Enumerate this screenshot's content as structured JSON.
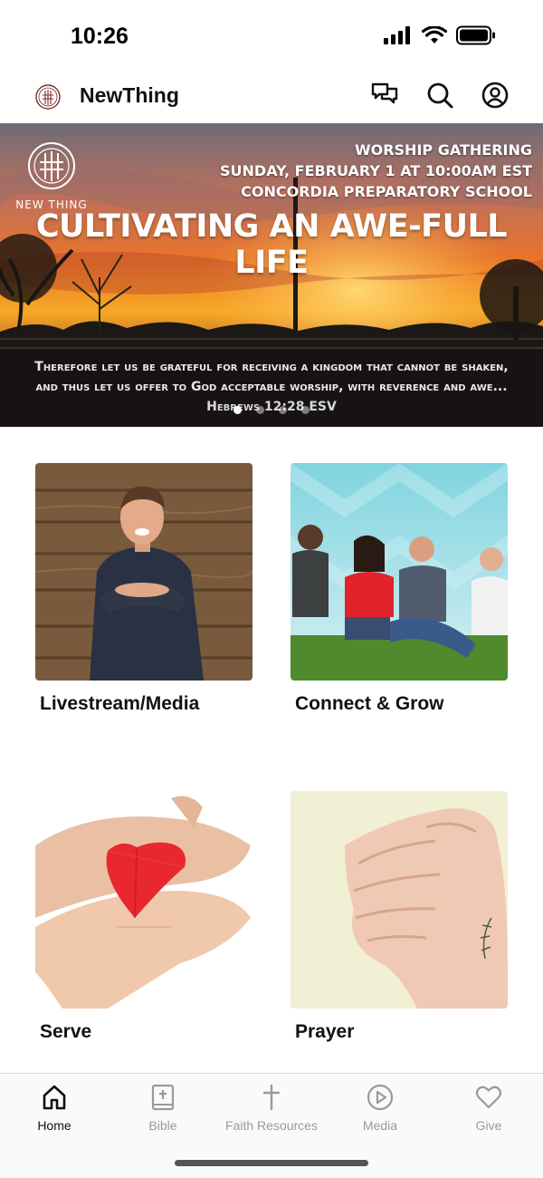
{
  "status_bar": {
    "time": "10:26"
  },
  "app": {
    "title": "NewThing",
    "actions": [
      "chat-icon",
      "search-icon",
      "profile-icon"
    ]
  },
  "hero": {
    "brand": "NEW THING",
    "event_lines": [
      "WORSHIP GATHERING",
      "SUNDAY, FEBRUARY 1 AT 10:00AM EST",
      "CONCORDIA PREPARATORY SCHOOL"
    ],
    "title": "CULTIVATING AN AWE-FULL LIFE",
    "verse_lines": [
      "Therefore let us be grateful for receiving a kingdom that cannot be shaken,",
      "and thus let us offer to God acceptable worship, with reverence and awe..."
    ],
    "verse_ref": "Hebrews 12:28 ESV",
    "carousel": {
      "total": 4,
      "active": 1
    }
  },
  "tiles": [
    {
      "label": "Livestream/Media",
      "image": "man-worship-photo"
    },
    {
      "label": "Connect & Grow",
      "image": "group-photo"
    },
    {
      "label": "Serve",
      "image": "hands-heart-photo"
    },
    {
      "label": "Prayer",
      "image": "praying-hands-photo"
    }
  ],
  "bottom_nav": {
    "active_index": 0,
    "items": [
      {
        "label": "Home",
        "icon": "home-icon"
      },
      {
        "label": "Bible",
        "icon": "bible-icon"
      },
      {
        "label": "Faith Resources",
        "icon": "cross-icon"
      },
      {
        "label": "Media",
        "icon": "play-icon"
      },
      {
        "label": "Give",
        "icon": "heart-icon"
      }
    ]
  },
  "colors": {
    "accent": "#111111",
    "inactive": "#9a9a9a",
    "nav_bg": "#fafafa"
  }
}
